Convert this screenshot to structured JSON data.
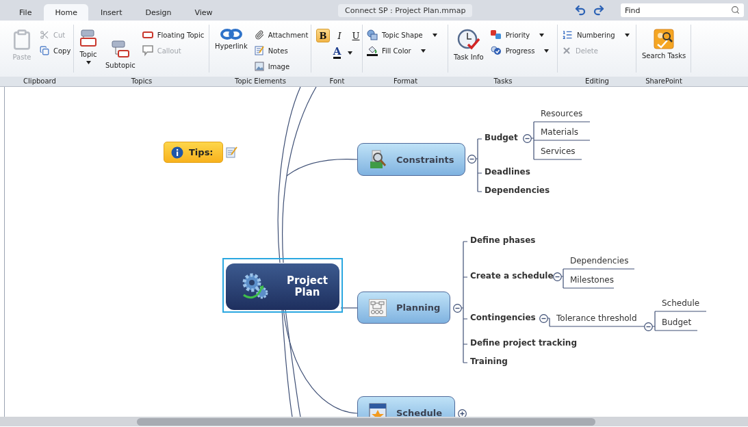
{
  "tabs": [
    {
      "label": "File",
      "selected": false
    },
    {
      "label": "Home",
      "selected": true
    },
    {
      "label": "Insert",
      "selected": false
    },
    {
      "label": "Design",
      "selected": false
    },
    {
      "label": "View",
      "selected": false
    }
  ],
  "document_title": "Connect SP : Project Plan.mmap",
  "find": {
    "placeholder": "Find"
  },
  "ribbon": [
    {
      "label": "Clipboard",
      "items": [
        {
          "kind": "large",
          "label": "Paste",
          "disabled": true
        },
        {
          "kind": "small",
          "label": "Cut",
          "disabled": true
        },
        {
          "kind": "small",
          "label": "Copy",
          "disabled": false
        }
      ]
    },
    {
      "label": "Topics",
      "items": [
        {
          "kind": "large",
          "label": "Topic",
          "disabled": false,
          "dropdown": true
        },
        {
          "kind": "large",
          "label": "Subtopic",
          "disabled": false
        },
        {
          "kind": "small",
          "label": "Floating Topic",
          "disabled": false
        },
        {
          "kind": "small",
          "label": "Callout",
          "disabled": true
        }
      ]
    },
    {
      "label": "Topic Elements",
      "items": [
        {
          "kind": "large",
          "label": "Hyperlink",
          "disabled": false
        },
        {
          "kind": "small",
          "label": "Attachment",
          "disabled": false
        },
        {
          "kind": "small",
          "label": "Notes",
          "disabled": false
        },
        {
          "kind": "small",
          "label": "Image",
          "disabled": false
        }
      ]
    },
    {
      "label": "Font",
      "items": [
        {
          "kind": "toggle",
          "label": "B",
          "selected": true
        },
        {
          "kind": "toggle",
          "label": "I",
          "selected": false
        },
        {
          "kind": "toggle",
          "label": "U",
          "selected": false
        },
        {
          "kind": "color",
          "label": "A",
          "dropdown": true
        }
      ]
    },
    {
      "label": "Format",
      "items": [
        {
          "kind": "small",
          "label": "Topic Shape",
          "disabled": false,
          "dropdown": true
        },
        {
          "kind": "small",
          "label": "Fill Color",
          "disabled": false,
          "dropdown": true
        }
      ]
    },
    {
      "label": "Tasks",
      "items": [
        {
          "kind": "large",
          "label": "Task Info",
          "disabled": false
        },
        {
          "kind": "small",
          "label": "Priority",
          "disabled": false,
          "dropdown": true
        },
        {
          "kind": "small",
          "label": "Progress",
          "disabled": false,
          "dropdown": true
        }
      ]
    },
    {
      "label": "Editing",
      "items": [
        {
          "kind": "small",
          "label": "Numbering",
          "disabled": false,
          "dropdown": true
        },
        {
          "kind": "small",
          "label": "Delete",
          "disabled": true
        }
      ]
    },
    {
      "label": "SharePoint",
      "items": [
        {
          "kind": "large",
          "label": "Search Tasks",
          "disabled": false
        }
      ]
    }
  ],
  "map": {
    "central": {
      "label": "Project Plan",
      "selected": true
    },
    "tips": {
      "label": "Tips:"
    },
    "branches": [
      {
        "label": "Constraints",
        "expanded": true,
        "children": [
          {
            "label": "Budget",
            "expanded": true,
            "children": [
              {
                "label": "Resources"
              },
              {
                "label": "Materials"
              },
              {
                "label": "Services"
              }
            ]
          },
          {
            "label": "Deadlines"
          },
          {
            "label": "Dependencies"
          }
        ]
      },
      {
        "label": "Planning",
        "expanded": true,
        "children": [
          {
            "label": "Define phases"
          },
          {
            "label": "Create a schedule",
            "expanded": true,
            "children": [
              {
                "label": "Dependencies"
              },
              {
                "label": "Milestones"
              }
            ]
          },
          {
            "label": "Contingencies",
            "expanded": true,
            "children": [
              {
                "label": "Tolerance threshold",
                "expanded": true,
                "children": [
                  {
                    "label": "Schedule"
                  },
                  {
                    "label": "Budget"
                  }
                ]
              }
            ]
          },
          {
            "label": "Define project tracking"
          },
          {
            "label": "Training"
          }
        ]
      },
      {
        "label": "Schedule",
        "expanded": false
      }
    ]
  }
}
